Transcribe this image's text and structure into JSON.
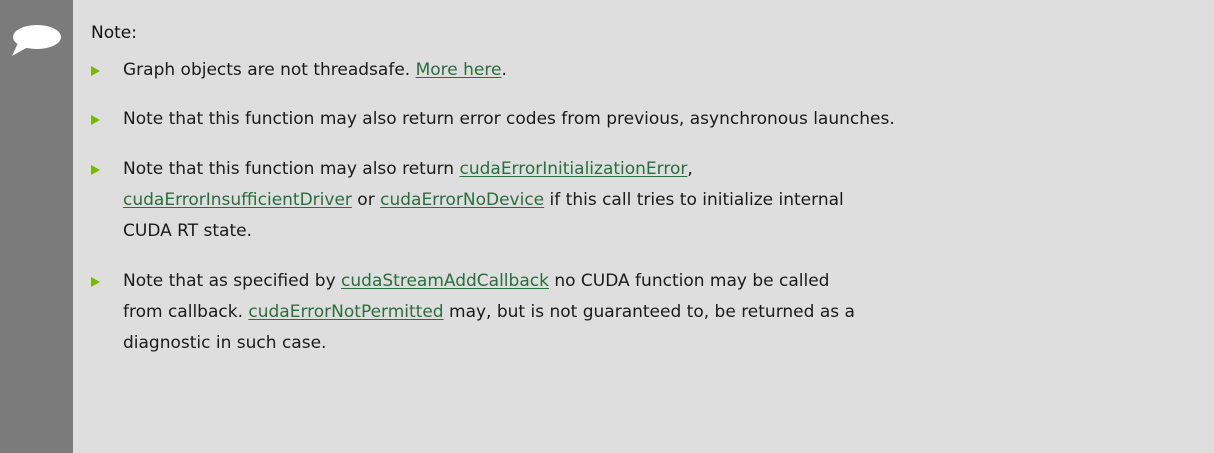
{
  "note": {
    "title": "Note:",
    "icon": "speech-bubble-icon",
    "accent_color": "#76b900",
    "link_color": "#2a6e3f",
    "items": [
      {
        "text_1": "Graph objects are not threadsafe. ",
        "link_1": "More here",
        "text_2": "."
      },
      {
        "text_1": "Note that this function may also return error codes from previous, asynchronous launches."
      },
      {
        "line1_text_1": "Note that this function may also return ",
        "link_1": "cudaErrorInitializationError",
        "line1_text_2": ",",
        "link_2": "cudaErrorInsufficientDriver",
        "line2_text_1": " or ",
        "link_3": "cudaErrorNoDevice",
        "line2_text_2": " if this call tries to initialize internal",
        "line3_text": "CUDA RT state."
      },
      {
        "line1_text_1": "Note that as specified by ",
        "link_1": "cudaStreamAddCallback",
        "line1_text_2": " no CUDA function may be called",
        "line2_text_1": "from callback. ",
        "link_2": "cudaErrorNotPermitted",
        "line2_text_2": " may, but is not guaranteed to, be returned as a",
        "line3_text": "diagnostic in such case."
      }
    ]
  }
}
